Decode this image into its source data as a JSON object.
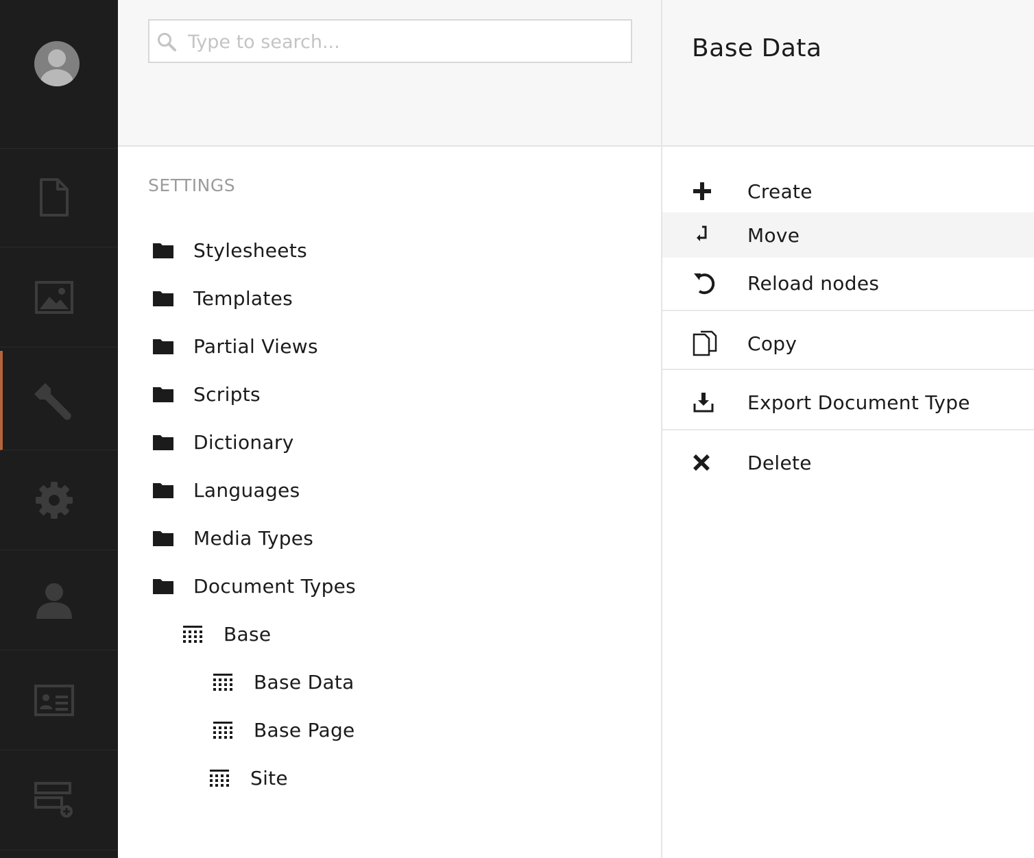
{
  "sidebar": {
    "items": [
      {
        "name": "content",
        "icon": "document-icon"
      },
      {
        "name": "media",
        "icon": "image-icon"
      },
      {
        "name": "settings",
        "icon": "wrench-icon",
        "active": true
      },
      {
        "name": "developer",
        "icon": "gear-icon"
      },
      {
        "name": "users",
        "icon": "user-icon"
      },
      {
        "name": "members",
        "icon": "id-card-icon"
      },
      {
        "name": "forms",
        "icon": "form-add-icon"
      }
    ],
    "active_color": "#b5653b"
  },
  "search": {
    "placeholder": "Type to search..."
  },
  "tree": {
    "section_title": "SETTINGS",
    "items": [
      {
        "label": "Stylesheets",
        "icon": "folder-icon"
      },
      {
        "label": "Templates",
        "icon": "folder-icon"
      },
      {
        "label": "Partial Views",
        "icon": "folder-icon"
      },
      {
        "label": "Scripts",
        "icon": "folder-icon"
      },
      {
        "label": "Dictionary",
        "icon": "folder-icon"
      },
      {
        "label": "Languages",
        "icon": "folder-icon"
      },
      {
        "label": "Media Types",
        "icon": "folder-icon"
      },
      {
        "label": "Document Types",
        "icon": "folder-icon"
      },
      {
        "label": "Base",
        "icon": "doc-type-icon"
      },
      {
        "label": "Base Data",
        "icon": "doc-type-icon"
      },
      {
        "label": "Base Page",
        "icon": "doc-type-icon"
      },
      {
        "label": "Site",
        "icon": "doc-type-icon"
      }
    ]
  },
  "actions": {
    "title": "Base Data",
    "items": [
      {
        "label": "Create",
        "icon": "plus-icon"
      },
      {
        "label": "Move",
        "icon": "move-icon"
      },
      {
        "label": "Reload nodes",
        "icon": "reload-icon"
      },
      {
        "label": "Copy",
        "icon": "copy-icon"
      },
      {
        "label": "Export Document Type",
        "icon": "export-icon"
      },
      {
        "label": "Delete",
        "icon": "delete-icon"
      }
    ]
  }
}
